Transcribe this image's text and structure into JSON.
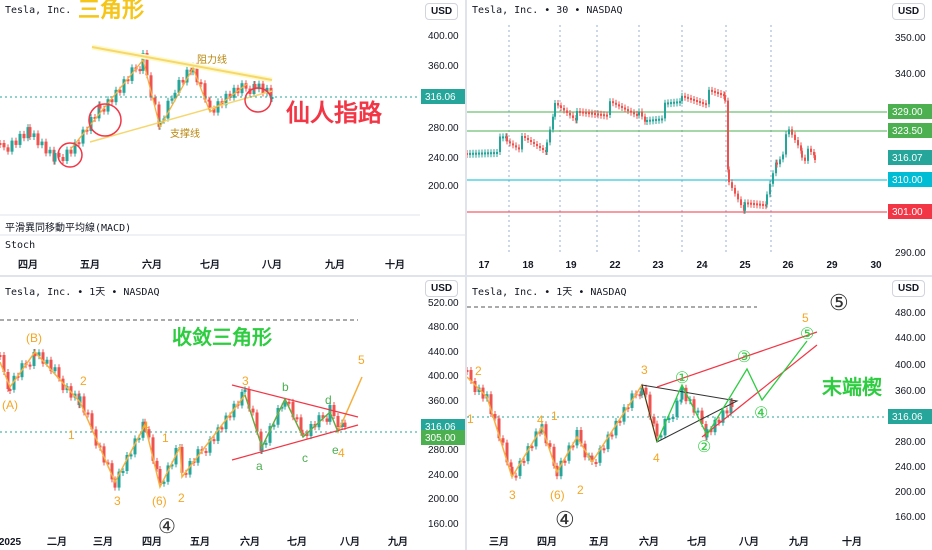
{
  "q1": {
    "header": "Tesla, Inc.",
    "title": "三角形",
    "resistance_label": "阻力线",
    "support_label": "支撑线",
    "annotation": "仙人指路",
    "macd_label": "平滑異同移動平均線(MACD)",
    "stoch_label": "Stoch",
    "currency": "USD",
    "price_tag": "316.06",
    "y_ticks": [
      "400.00",
      "360.00",
      "320.00",
      "280.00",
      "240.00",
      "200.00"
    ],
    "x_labels": [
      "四月",
      "五月",
      "六月",
      "七月",
      "八月",
      "九月",
      "十月"
    ]
  },
  "q2": {
    "header": "Tesla, Inc. • 30 • NASDAQ",
    "currency": "USD",
    "y_ticks": [
      "350.00",
      "340.00",
      "330.00",
      "320.00",
      "310.00",
      "300.00",
      "290.00"
    ],
    "level_tags": [
      {
        "label": "329.00",
        "color": "#4caf50"
      },
      {
        "label": "323.50",
        "color": "#4caf50"
      },
      {
        "label": "316.07",
        "color": "#26a69a"
      },
      {
        "label": "310.00",
        "color": "#00bcd4"
      },
      {
        "label": "301.00",
        "color": "#f23645"
      }
    ],
    "x_labels": [
      "17",
      "18",
      "19",
      "22",
      "23",
      "24",
      "25",
      "26",
      "29",
      "30"
    ]
  },
  "q3": {
    "header": "Tesla, Inc. • 1天 • NASDAQ",
    "title": "收敛三角形",
    "currency": "USD",
    "price_tags": [
      "316.06",
      "305.00"
    ],
    "y_ticks": [
      "520.00",
      "480.00",
      "440.00",
      "400.00",
      "360.00",
      "320.00",
      "280.00",
      "240.00",
      "200.00",
      "160.00"
    ],
    "x_labels": [
      "2025",
      "二月",
      "三月",
      "四月",
      "五月",
      "六月",
      "七月",
      "八月",
      "九月"
    ],
    "wave_labels": [
      "(B)",
      "(A)",
      "2",
      "1",
      "3",
      "4",
      "1",
      "(6)",
      "2",
      "3",
      "b",
      "a",
      "c",
      "d",
      "e",
      "4",
      "5"
    ],
    "circled": "④"
  },
  "q4": {
    "header": "Tesla, Inc. • 1天 • NASDAQ",
    "title": "末端楔",
    "currency": "USD",
    "price_tag": "316.06",
    "y_ticks": [
      "480.00",
      "440.00",
      "400.00",
      "360.00",
      "320.00",
      "280.00",
      "240.00",
      "200.00",
      "160.00"
    ],
    "x_labels": [
      "三月",
      "四月",
      "五月",
      "六月",
      "七月",
      "八月",
      "九月",
      "十月"
    ],
    "wave_labels": [
      "2",
      "1",
      "3",
      "4",
      "1",
      "(6)",
      "2",
      "3",
      "4",
      "5"
    ],
    "circled_waves": [
      "①",
      "②",
      "③",
      "④",
      "⑤"
    ],
    "big_circled_top": "⑤",
    "big_circled_bottom": "④"
  },
  "chart_data": [
    {
      "type": "line",
      "title": "三角形",
      "x": [
        "四月",
        "五月",
        "六月",
        "七月",
        "八月"
      ],
      "series": [
        {
          "values": [
            260,
            280,
            345,
            320,
            316
          ]
        }
      ],
      "ylim": [
        170,
        420
      ]
    },
    {
      "type": "line",
      "x": [
        "17",
        "18",
        "19",
        "22",
        "23",
        "24",
        "25",
        "26"
      ],
      "series": [
        {
          "values": [
            318,
            320,
            328,
            329,
            331,
            329,
            303,
            316
          ]
        }
      ],
      "ylim": [
        288,
        355
      ]
    },
    {
      "type": "line",
      "title": "收敛三角形",
      "x": [
        "2025",
        "二月",
        "三月",
        "四月",
        "五月",
        "六月",
        "七月",
        "八月"
      ],
      "series": [
        {
          "values": [
            400,
            380,
            240,
            240,
            280,
            340,
            310,
            316
          ]
        }
      ],
      "ylim": [
        150,
        530
      ]
    },
    {
      "type": "line",
      "title": "末端楔",
      "x": [
        "三月",
        "四月",
        "五月",
        "六月",
        "七月",
        "八月"
      ],
      "series": [
        {
          "values": [
            260,
            240,
            280,
            340,
            320,
            316
          ]
        }
      ],
      "ylim": [
        150,
        500
      ]
    }
  ]
}
